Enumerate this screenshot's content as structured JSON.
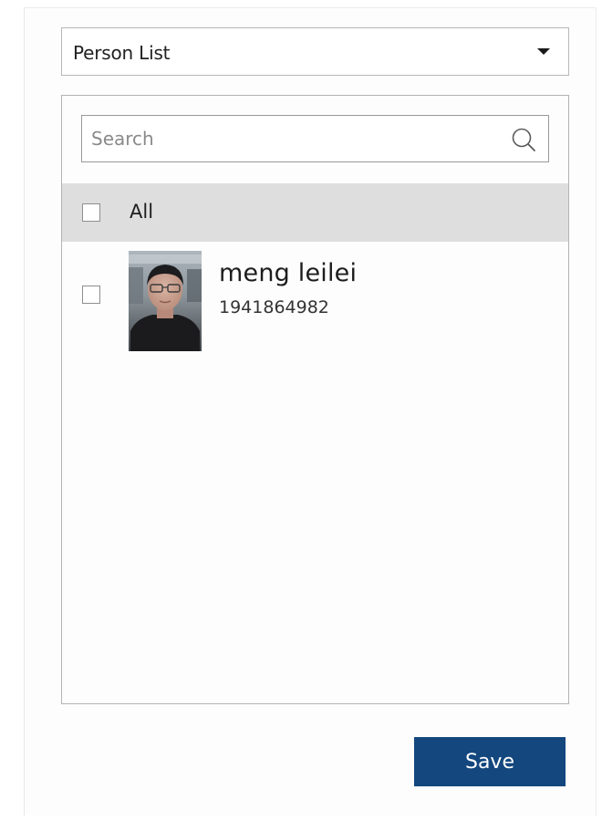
{
  "dropdown": {
    "selected": "Person List",
    "icon": "caret-down-icon"
  },
  "search": {
    "placeholder": "Search",
    "value": "",
    "icon": "search-icon"
  },
  "list": {
    "all_label": "All",
    "all_checked": false,
    "persons": [
      {
        "name": "meng leilei",
        "id": "1941864982",
        "checked": false,
        "photo": "avatar-photo"
      }
    ]
  },
  "actions": {
    "save_label": "Save"
  },
  "colors": {
    "accent": "#13477e",
    "header_row": "#dedede",
    "border": "#b3b3b3"
  }
}
